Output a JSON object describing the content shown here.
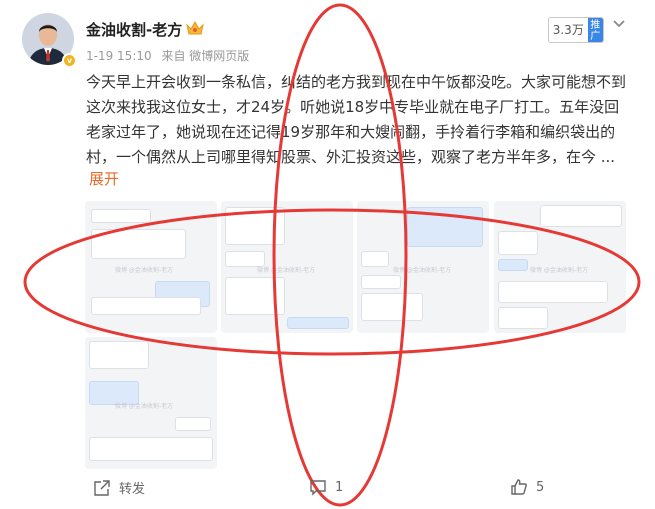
{
  "post": {
    "author": "金油收割-老方",
    "time": "1-19 15:10",
    "source": "来自 微博网页版",
    "text": "今天早上开会收到一条私信，纠结的老方我到现在中午饭都没吃。大家可能想不到这次来找我这位女士，才24岁。听她说18岁中专毕业就在电子厂打工。五年没回老家过年了，她说现在还记得19岁那年和大嫂闹翻，手拎着行李箱和编织袋出的村，一个偶然从上司哪里得知股票、外汇投资这些，观察了老方半年多，在今 ...",
    "expand_label": "展开",
    "verified_mark": "v"
  },
  "rank_badge": {
    "count": "3.3万",
    "tag": "推广"
  },
  "actions": {
    "repost_label": "转发",
    "comment_count": "1",
    "like_count": "5"
  },
  "colors": {
    "accent": "#e86b2a",
    "annotation": "#e53935",
    "badge_blue": "#3a86e6",
    "verified": "#f2b320"
  },
  "icons": [
    "crown-icon",
    "chevron-down-icon",
    "repost-icon",
    "comment-icon",
    "like-icon"
  ]
}
